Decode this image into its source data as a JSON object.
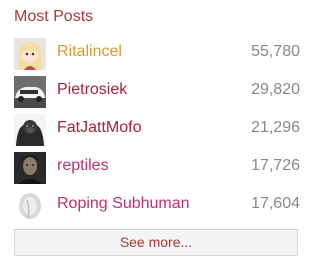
{
  "widget": {
    "title": "Most Posts",
    "see_more_label": "See more..."
  },
  "users": [
    {
      "name": "Ritalincel",
      "posts": "55,780",
      "name_color": "#d99a2b",
      "avatar": "anime-girl-avatar"
    },
    {
      "name": "Pietrosiek",
      "posts": "29,820",
      "name_color": "#a8223a",
      "avatar": "white-car-avatar"
    },
    {
      "name": "FatJattMofo",
      "posts": "21,296",
      "name_color": "#a8223a",
      "avatar": "gorilla-avatar"
    },
    {
      "name": "reptiles",
      "posts": "17,726",
      "name_color": "#c0306a",
      "avatar": "man-portrait-avatar"
    },
    {
      "name": "Roping Subhuman",
      "posts": "17,604",
      "name_color": "#c0306a",
      "avatar": "default-avatar"
    }
  ]
}
